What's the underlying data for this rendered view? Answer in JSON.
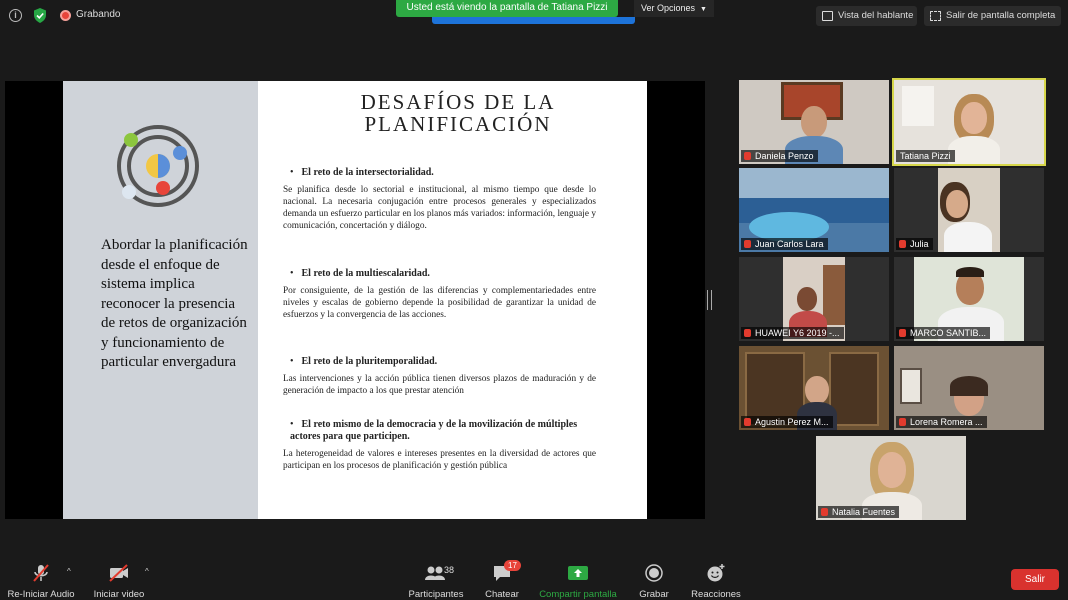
{
  "topbar": {
    "recording_label": "Grabando",
    "banner_text": "Usted está viendo la pantalla de Tatiana Pizzi",
    "view_options_label": "Ver Opciones",
    "speaker_view_label": "Vista del hablante",
    "fullscreen_label": "Salir de pantalla completa"
  },
  "slide": {
    "title_line1": "DESAFÍOS DE LA",
    "title_line2": "PLANIFICACIÓN",
    "lead_text": "Abordar la planificación desde el enfoque de sistema implica reconocer la presencia de retos de organización y funcionamiento de particular envergadura",
    "sections": [
      {
        "heading": "El reto de la intersectorialidad.",
        "body": "Se planifica desde lo sectorial e institucional, al mismo tiempo que desde lo nacional. La necesaria conjugación entre procesos generales y especializados demanda un esfuerzo particular en los planos más variados: información, lenguaje y comunicación, concertación y diálogo."
      },
      {
        "heading": "El reto de la multiescalaridad.",
        "body": "Por consiguiente, de la gestión de las diferencias y complementariedades entre niveles y escalas de gobierno depende la posibilidad de garantizar la unidad de esfuerzos y la convergencia de las acciones."
      },
      {
        "heading": "El reto de la pluritemporalidad.",
        "body": "Las intervenciones y la acción pública tienen diversos plazos de maduración y de generación de impacto a los que prestar atención"
      },
      {
        "heading": "El reto mismo de la democracia y de la movilización de múltiples actores para que participen.",
        "body": "La heterogeneidad de valores e intereses presentes en la diversidad de actores que participan en los procesos de planificación y gestión pública"
      }
    ]
  },
  "participants": [
    {
      "name": "Daniela Penzo",
      "muted": true
    },
    {
      "name": "Tatiana Pizzi",
      "muted": false
    },
    {
      "name": "Juan Carlos Lara",
      "muted": true
    },
    {
      "name": "Julia",
      "muted": true
    },
    {
      "name": "HUAWEI Y6 2019 -...",
      "muted": true
    },
    {
      "name": "MARCO SANTIB...",
      "muted": true
    },
    {
      "name": "Agustin Perez M...",
      "muted": true
    },
    {
      "name": "Lorena Romera ...",
      "muted": true
    },
    {
      "name": "Natalia Fuentes",
      "muted": true
    }
  ],
  "toolbar": {
    "audio_label": "Re-Iniciar Audio",
    "video_label": "Iniciar video",
    "participants_label": "Participantes",
    "participants_count": "38",
    "chat_label": "Chatear",
    "chat_badge": "17",
    "share_label": "Compartir pantalla",
    "record_label": "Grabar",
    "reactions_label": "Reacciones",
    "leave_label": "Salir"
  },
  "colors": {
    "banner_green": "#2da943",
    "share_green": "#2da943",
    "leave_red": "#d9322e",
    "muted_red": "#e23b2e"
  }
}
